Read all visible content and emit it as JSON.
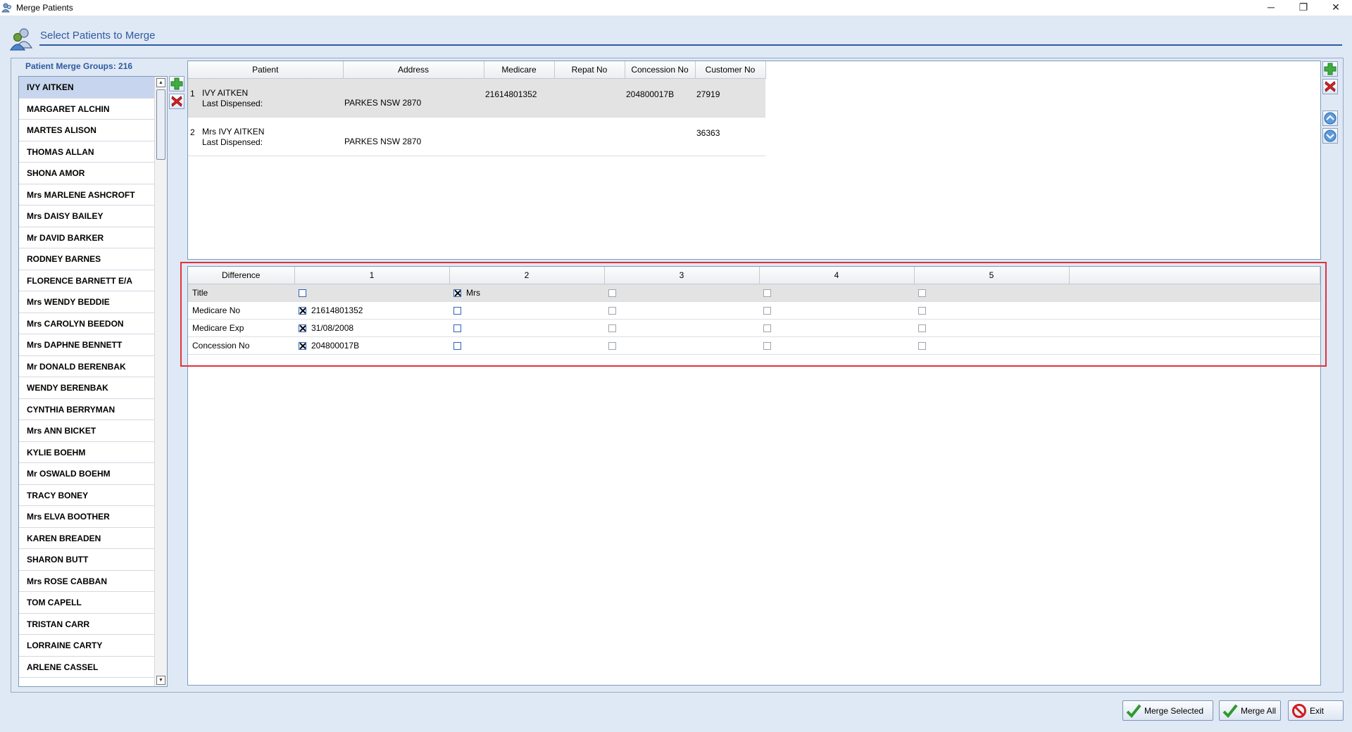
{
  "window": {
    "title": "Merge Patients",
    "minimize_glyph": "─",
    "maximize_glyph": "❐",
    "close_glyph": "✕"
  },
  "header": {
    "title": "Select Patients to Merge"
  },
  "groups": {
    "label": "Patient Merge Groups: 216",
    "patients": [
      "IVY AITKEN",
      "MARGARET ALCHIN",
      "MARTES ALISON",
      "THOMAS ALLAN",
      "SHONA AMOR",
      "Mrs MARLENE ASHCROFT",
      "Mrs DAISY BAILEY",
      "Mr DAVID BARKER",
      "RODNEY BARNES",
      "FLORENCE BARNETT E/A",
      "Mrs WENDY BEDDIE",
      "Mrs CAROLYN BEEDON",
      "Mrs DAPHNE BENNETT",
      "Mr DONALD BERENBAK",
      "WENDY BERENBAK",
      "CYNTHIA BERRYMAN",
      "Mrs ANN BICKET",
      "KYLIE BOEHM",
      "Mr OSWALD BOEHM",
      "TRACY BONEY",
      "Mrs ELVA BOOTHER",
      "KAREN BREADEN",
      "SHARON BUTT",
      "Mrs ROSE CABBAN",
      "TOM CAPELL",
      "TRISTAN CARR",
      "LORRAINE CARTY",
      "ARLENE CASSEL"
    ]
  },
  "patient_table": {
    "columns": [
      "Patient",
      "Address",
      "Medicare",
      "Repat No",
      "Concession No",
      "Customer No"
    ],
    "rows": [
      {
        "index": "1",
        "name": "IVY AITKEN",
        "last_dispensed_label": "Last Dispensed:",
        "address": "PARKES NSW 2870",
        "medicare": "21614801352",
        "repat": "",
        "concession": "204800017B",
        "customer": "27919"
      },
      {
        "index": "2",
        "name": "Mrs IVY AITKEN",
        "last_dispensed_label": "Last Dispensed:",
        "address": "PARKES NSW 2870",
        "medicare": "",
        "repat": "",
        "concession": "",
        "customer": "36363"
      }
    ]
  },
  "difference_table": {
    "columns": [
      "Difference",
      "1",
      "2",
      "3",
      "4",
      "5"
    ],
    "rows": [
      {
        "field": "Title",
        "values": [
          {
            "checked": false,
            "text": ""
          },
          {
            "checked": true,
            "text": "Mrs"
          },
          {
            "checked": false,
            "text": ""
          },
          {
            "checked": false,
            "text": ""
          },
          {
            "checked": false,
            "text": ""
          }
        ]
      },
      {
        "field": "Medicare No",
        "values": [
          {
            "checked": true,
            "text": "21614801352"
          },
          {
            "checked": false,
            "text": ""
          },
          {
            "checked": false,
            "text": ""
          },
          {
            "checked": false,
            "text": ""
          },
          {
            "checked": false,
            "text": ""
          }
        ]
      },
      {
        "field": "Medicare Exp",
        "values": [
          {
            "checked": true,
            "text": "31/08/2008"
          },
          {
            "checked": false,
            "text": ""
          },
          {
            "checked": false,
            "text": ""
          },
          {
            "checked": false,
            "text": ""
          },
          {
            "checked": false,
            "text": ""
          }
        ]
      },
      {
        "field": "Concession No",
        "values": [
          {
            "checked": true,
            "text": "204800017B"
          },
          {
            "checked": false,
            "text": ""
          },
          {
            "checked": false,
            "text": ""
          },
          {
            "checked": false,
            "text": ""
          },
          {
            "checked": false,
            "text": ""
          }
        ]
      }
    ]
  },
  "buttons": {
    "merge_selected": "Merge Selected",
    "merge_all": "Merge All",
    "exit": "Exit"
  },
  "icons": {
    "add": "plus-icon",
    "delete": "red-x-icon",
    "up": "chevron-up-icon",
    "down": "chevron-down-icon",
    "check": "green-check-icon",
    "exit": "no-entry-icon"
  },
  "colors": {
    "accent": "#2f5aa0",
    "highlight_box": "#e0333a",
    "selected_row": "#c7d6ee"
  }
}
